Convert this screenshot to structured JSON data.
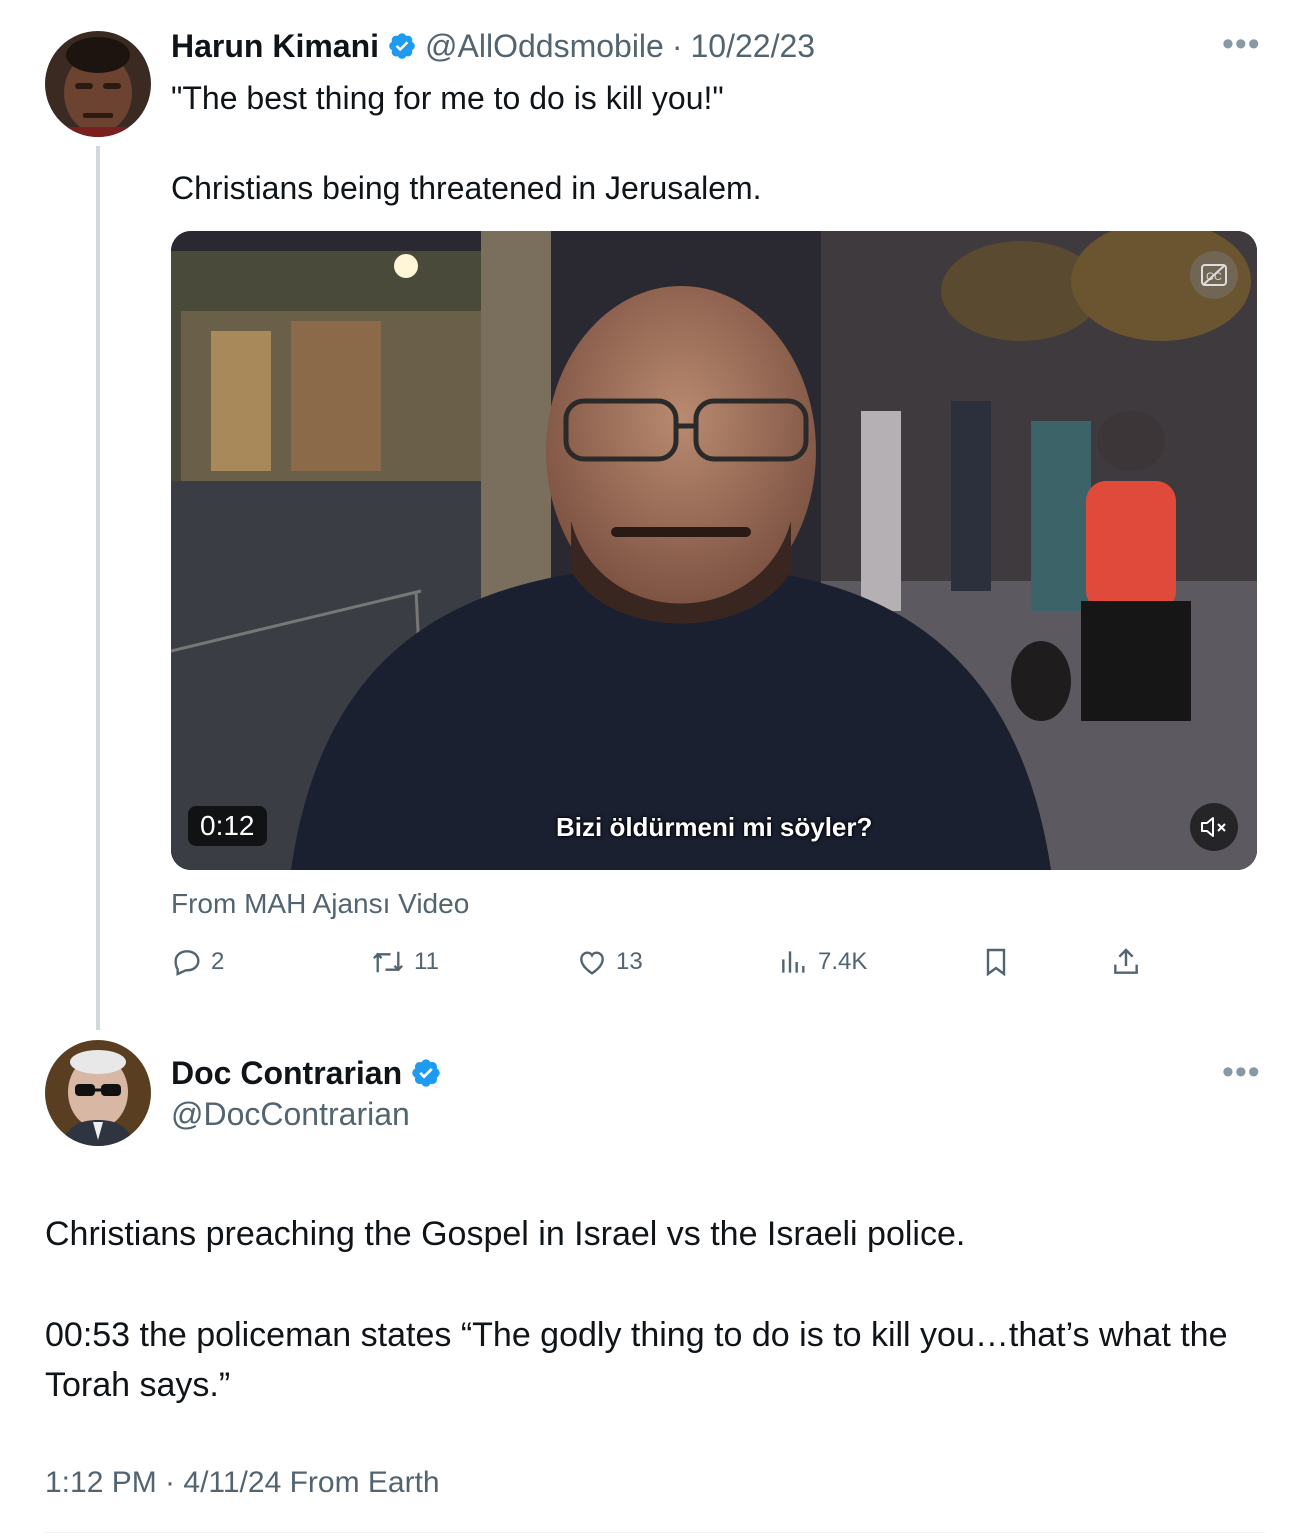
{
  "quoted_tweet": {
    "author_name": "Harun Kimani",
    "handle": "@AllOddsmobile",
    "separator": "·",
    "date": "10/22/23",
    "text_line1": "\"The best thing for me to do is kill you!\"",
    "text_line2": "Christians being threatened in Jerusalem.",
    "video": {
      "duration": "0:12",
      "subtitle": "Bizi öldürmeni mi söyler?"
    },
    "source": "From MAH Ajansı Video",
    "actions": {
      "replies": "2",
      "retweets": "11",
      "likes": "13",
      "views": "7.4K"
    }
  },
  "main_tweet": {
    "author_name": "Doc Contrarian",
    "handle": "@DocContrarian",
    "text_para1": "Christians preaching the Gospel in Israel vs the Israeli police.",
    "text_para2": "00:53 the policeman states “The godly thing to do is to kill you…that’s what the Torah says.”",
    "timestamp": "1:12 PM · 4/11/24 From Earth"
  },
  "icons": {
    "verified": "verified-badge-icon",
    "more": "more-options-icon",
    "reply": "reply-icon",
    "retweet": "retweet-icon",
    "like": "like-icon",
    "views": "views-icon",
    "bookmark": "bookmark-icon",
    "share": "share-icon",
    "captions": "captions-icon",
    "mute": "mute-icon"
  },
  "colors": {
    "verified": "#1d9bf0",
    "muted_text": "#536471",
    "thread_line": "#cfd9de"
  }
}
